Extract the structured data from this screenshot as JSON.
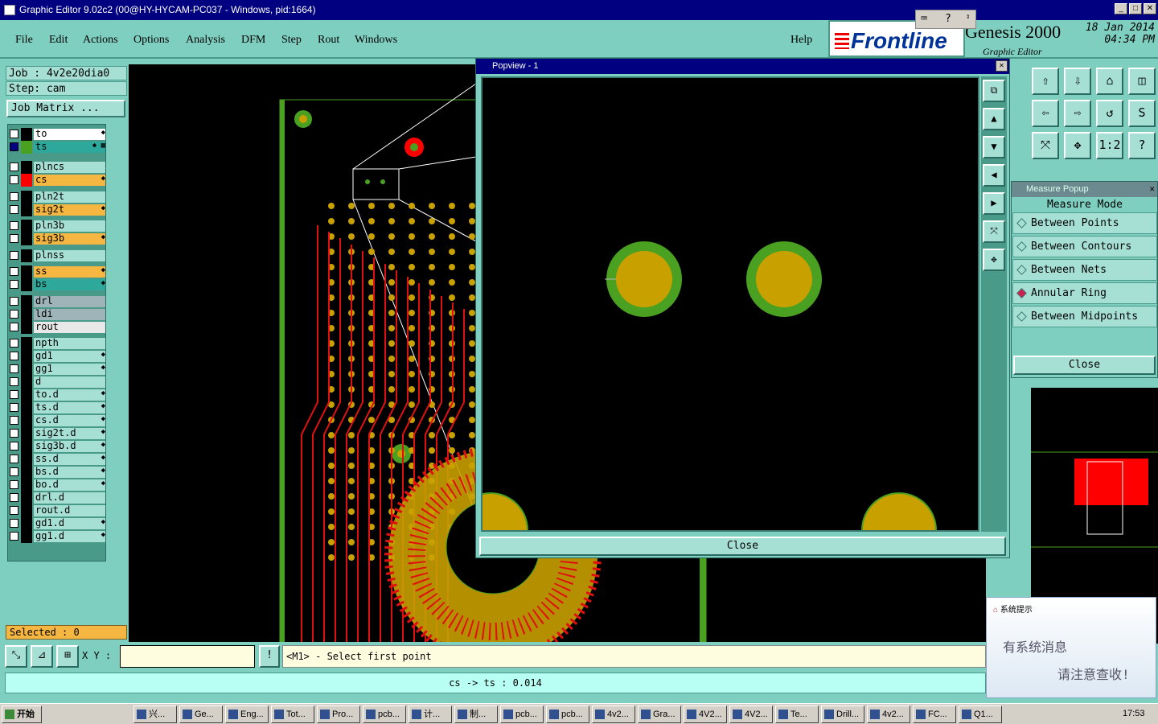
{
  "window": {
    "title": "Graphic Editor 9.02c2 (00@HY-HYCAM-PC037 - Windows, pid:1664)"
  },
  "menu": [
    "File",
    "Edit",
    "Actions",
    "Options",
    "Analysis",
    "DFM",
    "Step",
    "Rout",
    "Windows"
  ],
  "help": "Help",
  "brand": {
    "logo": "Frontline",
    "product": "Genesis 2000",
    "subtitle": "Graphic Editor",
    "date": "18 Jan 2014",
    "time": "04:34 PM"
  },
  "job": {
    "job": "Job : 4v2e20dia0",
    "step": "Step: cam",
    "matrix_button": "Job Matrix ..."
  },
  "layers": [
    {
      "name": "to",
      "color": "#ffffff",
      "swatch": "#000000",
      "arrow": "◆"
    },
    {
      "name": "ts",
      "color": "#2ea89a",
      "swatch": "#4aa020",
      "arrow": "◆ ▦",
      "active": true
    },
    {
      "name": "plncs",
      "color": "#a6e0d5",
      "swatch": "#000000",
      "arrow": ""
    },
    {
      "name": "cs",
      "color": "#f5b642",
      "swatch": "#ff0000",
      "arrow": "◆"
    },
    {
      "name": "pln2t",
      "color": "#a6e0d5",
      "swatch": "#000000",
      "arrow": ""
    },
    {
      "name": "sig2t",
      "color": "#f5b642",
      "swatch": "#000000",
      "arrow": "◆"
    },
    {
      "name": "pln3b",
      "color": "#a6e0d5",
      "swatch": "#000000",
      "arrow": ""
    },
    {
      "name": "sig3b",
      "color": "#f5b642",
      "swatch": "#000000",
      "arrow": "◆"
    },
    {
      "name": "plnss",
      "color": "#a6e0d5",
      "swatch": "#000000",
      "arrow": ""
    },
    {
      "name": "ss",
      "color": "#f5b642",
      "swatch": "#000000",
      "arrow": "◆"
    },
    {
      "name": "bs",
      "color": "#2ea89a",
      "swatch": "#000000",
      "arrow": "◆"
    },
    {
      "name": "drl",
      "color": "#9eb4b8",
      "swatch": "#000000",
      "arrow": ""
    },
    {
      "name": "ldi",
      "color": "#9eb4b8",
      "swatch": "#000000",
      "arrow": ""
    },
    {
      "name": "rout",
      "color": "#e8e8e8",
      "swatch": "#000000",
      "arrow": ""
    },
    {
      "name": "npth",
      "color": "#a6e0d5",
      "swatch": "#000000",
      "arrow": ""
    },
    {
      "name": "gd1",
      "color": "#a6e0d5",
      "swatch": "#000000",
      "arrow": "◆"
    },
    {
      "name": "gg1",
      "color": "#a6e0d5",
      "swatch": "#000000",
      "arrow": "◆"
    },
    {
      "name": "d",
      "color": "#a6e0d5",
      "swatch": "#000000",
      "arrow": ""
    },
    {
      "name": "to.d",
      "color": "#a6e0d5",
      "swatch": "#000000",
      "arrow": "◆"
    },
    {
      "name": "ts.d",
      "color": "#a6e0d5",
      "swatch": "#000000",
      "arrow": "◆"
    },
    {
      "name": "cs.d",
      "color": "#a6e0d5",
      "swatch": "#000000",
      "arrow": "◆"
    },
    {
      "name": "sig2t.d",
      "color": "#a6e0d5",
      "swatch": "#000000",
      "arrow": "◆"
    },
    {
      "name": "sig3b.d",
      "color": "#a6e0d5",
      "swatch": "#000000",
      "arrow": "◆"
    },
    {
      "name": "ss.d",
      "color": "#a6e0d5",
      "swatch": "#000000",
      "arrow": "◆"
    },
    {
      "name": "bs.d",
      "color": "#a6e0d5",
      "swatch": "#000000",
      "arrow": "◆"
    },
    {
      "name": "bo.d",
      "color": "#a6e0d5",
      "swatch": "#000000",
      "arrow": "◆"
    },
    {
      "name": "drl.d",
      "color": "#a6e0d5",
      "swatch": "#000000",
      "arrow": ""
    },
    {
      "name": "rout.d",
      "color": "#a6e0d5",
      "swatch": "#000000",
      "arrow": ""
    },
    {
      "name": "gd1.d",
      "color": "#a6e0d5",
      "swatch": "#000000",
      "arrow": "◆"
    },
    {
      "name": "gg1.d",
      "color": "#a6e0d5",
      "swatch": "#000000",
      "arrow": "◆"
    }
  ],
  "selected": "Selected : 0",
  "popview": {
    "title": "Popview - 1",
    "close": "Close"
  },
  "measure": {
    "title": "Measure Popup",
    "header": "Measure Mode",
    "options": [
      "Between Points",
      "Between Contours",
      "Between Nets",
      "Annular Ring",
      "Between Midpoints"
    ],
    "selected_index": 3,
    "close": "Close"
  },
  "toolgrid_labels": [
    "⇧",
    "⇩",
    "⌂",
    "◫",
    "⇦",
    "⇨",
    "↺",
    "S",
    "⤧",
    "✥",
    "1:2",
    "?"
  ],
  "bottom": {
    "xy_label": "X Y :",
    "xy_value": "",
    "prompt": "<M1> - Select first point"
  },
  "status": "cs -> ts : 0.014",
  "notify": {
    "title": "系统提示",
    "line1": "有系统消息",
    "line2": "请注意查收!"
  },
  "taskbar": {
    "start": "开始",
    "clock": "17:53",
    "items": [
      "兴...",
      "Ge...",
      "Eng...",
      "Tot...",
      "Pro...",
      "pcb...",
      "计...",
      "制...",
      "pcb...",
      "pcb...",
      "4v2...",
      "Gra...",
      "4V2...",
      "4V2...",
      "Te...",
      "Drill...",
      "4v2...",
      "FC...",
      "Q1..."
    ]
  },
  "colors": {
    "teal": "#7ecfc0",
    "pad": "#c8a000",
    "ring": "#4aa020",
    "trace": "#e01010"
  }
}
